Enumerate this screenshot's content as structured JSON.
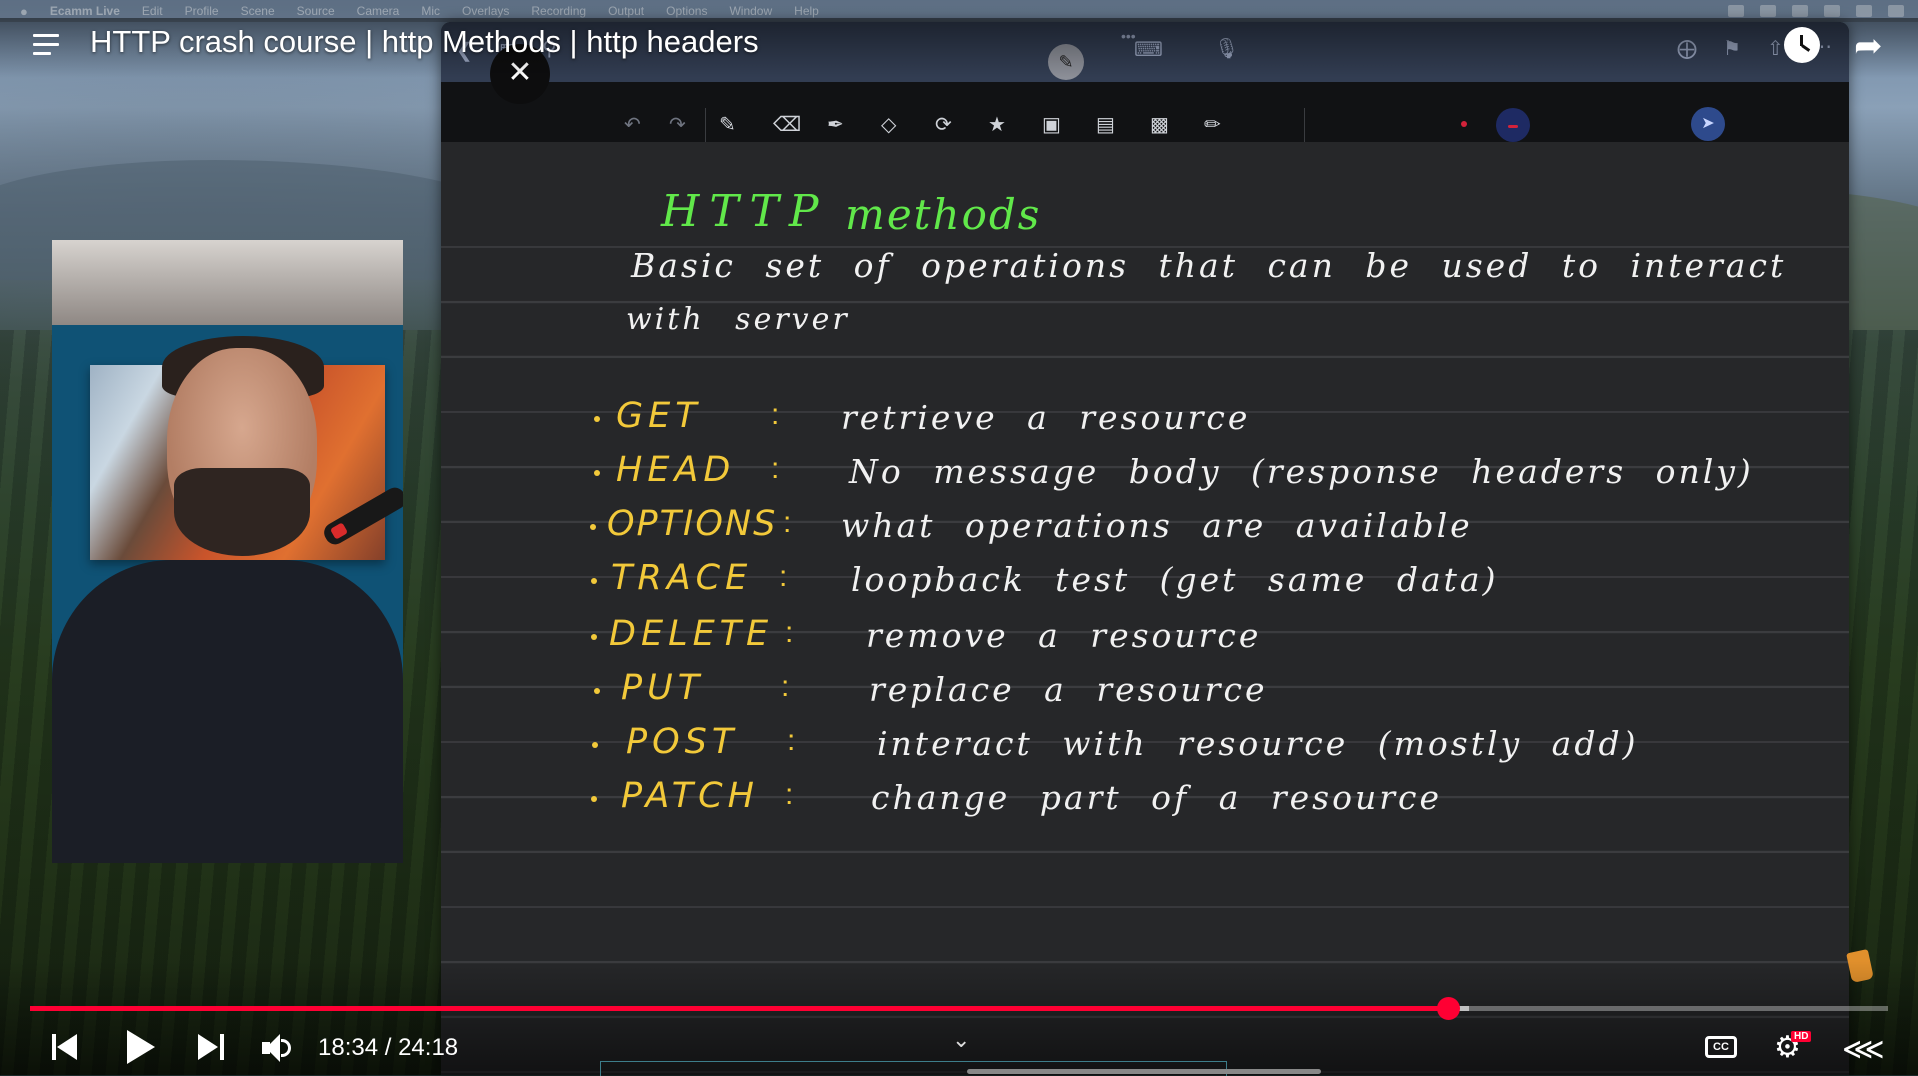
{
  "menubar": {
    "app": "Ecamm Live",
    "items": [
      "Edit",
      "Profile",
      "Scene",
      "Source",
      "Camera",
      "Mic",
      "Overlays",
      "Recording",
      "Output",
      "Options",
      "Window",
      "Help"
    ]
  },
  "player": {
    "title": "HTTP crash course | http Methods | http headers",
    "current_time": "18:34",
    "separator": " / ",
    "duration": "24:18",
    "time_display": "18:34 / 24:18",
    "progress_fraction": 0.7634,
    "buffered_fraction": 0.7745,
    "hd_badge": "HD",
    "cc_label": "CC",
    "accent_color": "#ff0033"
  },
  "notes": {
    "heading_word1": "HTTP",
    "heading_word2": "methods",
    "description_line1": "Basic set of operations that can be used to interact",
    "description_line2": "with server",
    "heading_color": "#61e84a",
    "method_color": "#f2c93a",
    "methods": [
      {
        "name": "GET",
        "colon": ":",
        "desc": "retrieve a resource"
      },
      {
        "name": "HEAD",
        "colon": ":",
        "desc": "No message body (response headers only)"
      },
      {
        "name": "OPTIONS",
        "colon": ":",
        "desc": "what operations are available"
      },
      {
        "name": "TRACE",
        "colon": ":",
        "desc": "loopback test (get same data)"
      },
      {
        "name": "DELETE",
        "colon": ":",
        "desc": "remove a resource"
      },
      {
        "name": "PUT",
        "colon": ":",
        "desc": "replace a resource"
      },
      {
        "name": "POST",
        "colon": ":",
        "desc": "interact with resource (mostly add)"
      },
      {
        "name": "PATCH",
        "colon": ":",
        "desc": "change part of a resource"
      }
    ]
  },
  "icons": {
    "menu": "menu-icon",
    "watch_later": "clock-icon",
    "share": "share-arrow-icon",
    "close": "close-icon",
    "back": "chevron-left-icon",
    "grid": "grid-icon",
    "search": "search-icon",
    "pen_mode": "pen-icon",
    "keyboard": "keyboard-icon",
    "mic": "microphone-icon",
    "add_page": "add-page-icon",
    "bookmark": "bookmark-icon",
    "export": "export-icon",
    "more": "more-icon",
    "undo": "undo-icon",
    "redo": "redo-icon",
    "pencil": "pencil-icon",
    "eraser": "eraser-icon",
    "highlighter": "highlighter-icon",
    "shapes": "shapes-icon",
    "lasso": "lasso-icon",
    "sticker": "sticker-icon",
    "image": "image-icon",
    "textbox": "textbox-icon",
    "scan": "scan-icon",
    "ruler": "ruler-icon",
    "laser": "laser-pointer-icon"
  }
}
